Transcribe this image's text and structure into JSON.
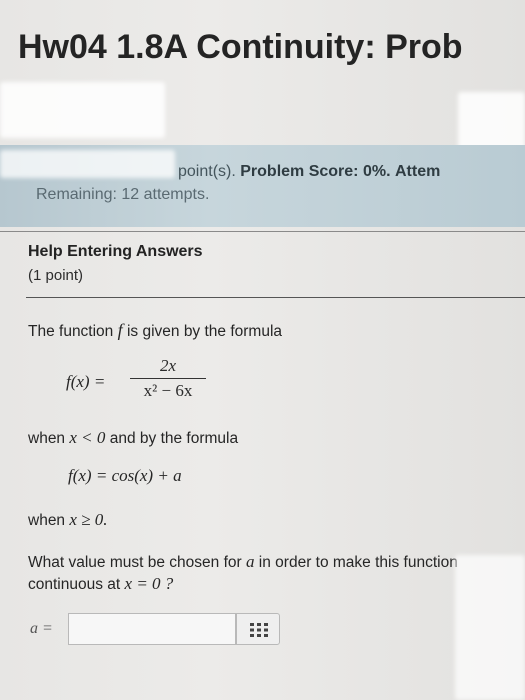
{
  "header": {
    "title": "Hw04 1.8A Continuity: Prob"
  },
  "score": {
    "points_suffix": "point(s).",
    "problem_score": "Problem Score: 0%.",
    "attempts_fragment": "Attem",
    "remaining": "Remaining: 12 attempts."
  },
  "help": {
    "title": "Help Entering Answers",
    "points": "(1 point)"
  },
  "problem": {
    "intro": "The function",
    "intro_var": "f",
    "intro_tail": "is given by the formula",
    "formula1_lhs": "f(x) =",
    "formula1_num": "2x",
    "formula1_den": "x² − 6x",
    "cond1_pre": "when",
    "cond1_math": "x < 0",
    "cond1_post": "and by the formula",
    "formula2": "f(x) = cos(x) + a",
    "cond2_pre": "when",
    "cond2_math": "x ≥ 0.",
    "question_line1_pre": "What value must be chosen for",
    "question_var": "a",
    "question_line1_post": "in order to make this function",
    "question_line2_pre": "continuous at",
    "question_line2_math": "x = 0 ?"
  },
  "answer": {
    "label": "a =",
    "value": ""
  }
}
